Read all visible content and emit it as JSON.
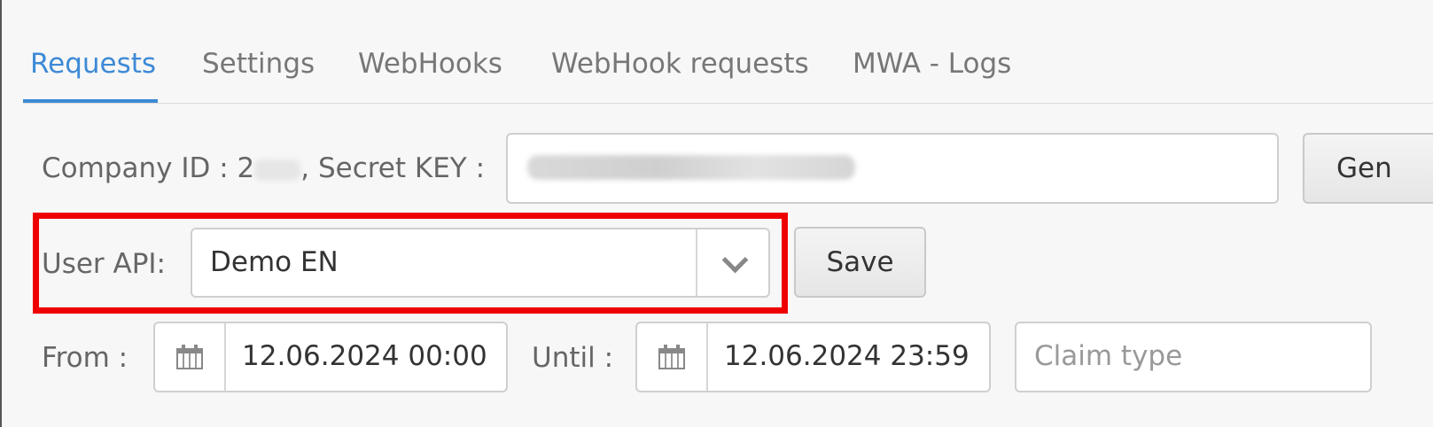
{
  "tabs": [
    {
      "label": "Requests",
      "active": true
    },
    {
      "label": "Settings"
    },
    {
      "label": "WebHooks"
    },
    {
      "label": "WebHook requests"
    },
    {
      "label": "MWA - Logs"
    }
  ],
  "credentials": {
    "company_label": "Company ID : 2",
    "secret_label": ", Secret KEY :",
    "generate_button": "Gen"
  },
  "user_api": {
    "label": "User API:",
    "selected": "Demo EN",
    "save_button": "Save"
  },
  "filters": {
    "from_label": "From :",
    "from_value": "12.06.2024 00:00",
    "until_label": "Until :",
    "until_value": "12.06.2024 23:59",
    "claim_type_placeholder": "Claim type"
  },
  "colors": {
    "accent": "#3d8ad6",
    "highlight": "#ee0000"
  }
}
